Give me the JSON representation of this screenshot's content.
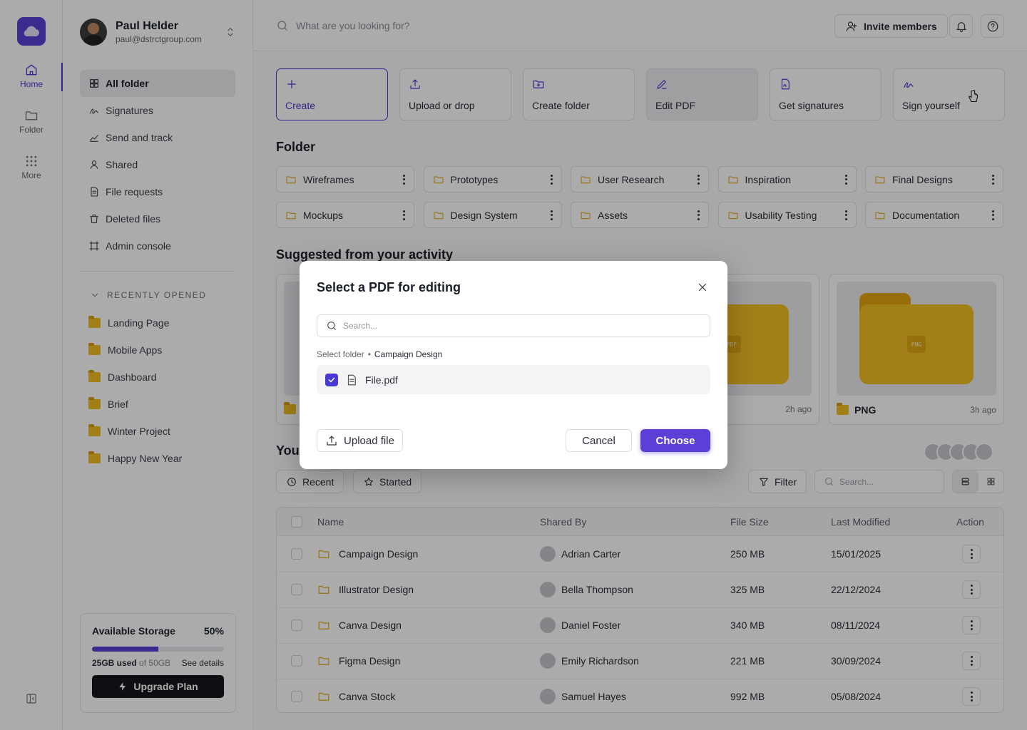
{
  "rail": {
    "items": [
      {
        "label": "Home",
        "icon": "home-icon"
      },
      {
        "label": "Folder",
        "icon": "folder-icon"
      },
      {
        "label": "More",
        "icon": "grid-icon"
      }
    ]
  },
  "user": {
    "name": "Paul Helder",
    "email": "paul@dstrctgroup.com"
  },
  "sidebar": {
    "nav": [
      {
        "label": "All folder",
        "icon": "grid-icon"
      },
      {
        "label": "Signatures",
        "icon": "signature-icon"
      },
      {
        "label": "Send and track",
        "icon": "chart-icon"
      },
      {
        "label": "Shared",
        "icon": "user-icon"
      },
      {
        "label": "File requests",
        "icon": "file-request-icon"
      },
      {
        "label": "Deleted files",
        "icon": "trash-icon"
      },
      {
        "label": "Admin console",
        "icon": "console-icon"
      }
    ],
    "recent_heading": "RECENTLY OPENED",
    "recent": [
      "Landing Page",
      "Mobile Apps",
      "Dashboard",
      "Brief",
      "Winter Project",
      "Happy New Year"
    ]
  },
  "storage": {
    "title": "Available Storage",
    "percent_label": "50%",
    "fill_fraction": 0.5,
    "used": "25GB used",
    "total": "of 50GB",
    "details": "See details",
    "upgrade": "Upgrade Plan"
  },
  "topbar": {
    "search_placeholder": "What are you looking for?",
    "invite": "Invite members"
  },
  "actions": [
    "Create",
    "Upload or drop",
    "Create folder",
    "Edit PDF",
    "Get signatures",
    "Sign yourself"
  ],
  "folder_heading": "Folder",
  "folders": [
    "Wireframes",
    "Prototypes",
    "User Research",
    "Inspiration",
    "Final Designs",
    "Mockups",
    "Design System",
    "Assets",
    "Usability Testing",
    "Documentation"
  ],
  "suggested_heading": "Suggested from your activity",
  "cards": [
    {
      "tag": "PDF",
      "time": "2h ago"
    },
    {
      "tag": "PNG",
      "name": "PNG",
      "time": "3h ago"
    }
  ],
  "files_heading": "You",
  "filters": {
    "recent": "Recent",
    "started": "Started",
    "filter": "Filter",
    "search_placeholder": "Search..."
  },
  "table": {
    "headers": [
      "Name",
      "Shared By",
      "File Size",
      "Last Modified",
      "Action"
    ],
    "rows": [
      {
        "name": "Campaign Design",
        "shared_by": "Adrian Carter",
        "size": "250 MB",
        "modified": "15/01/2025"
      },
      {
        "name": "Illustrator Design",
        "shared_by": "Bella Thompson",
        "size": "325 MB",
        "modified": "22/12/2024"
      },
      {
        "name": "Canva Design",
        "shared_by": "Daniel Foster",
        "size": "340 MB",
        "modified": "08/11/2024"
      },
      {
        "name": "Figma Design",
        "shared_by": "Emily Richardson",
        "size": "221 MB",
        "modified": "30/09/2024"
      },
      {
        "name": "Canva Stock",
        "shared_by": "Samuel Hayes",
        "size": "992 MB",
        "modified": "05/08/2024"
      }
    ]
  },
  "modal": {
    "title": "Select a PDF for editing",
    "search_placeholder": "Search...",
    "crumb_label": "Select folder",
    "crumb_sep": "•",
    "crumb_folder": "Campaign Design",
    "file": "File.pdf",
    "upload": "Upload file",
    "cancel": "Cancel",
    "choose": "Choose"
  },
  "colors": {
    "accent": "#5b3fd6",
    "folder": "#f2bf24"
  }
}
